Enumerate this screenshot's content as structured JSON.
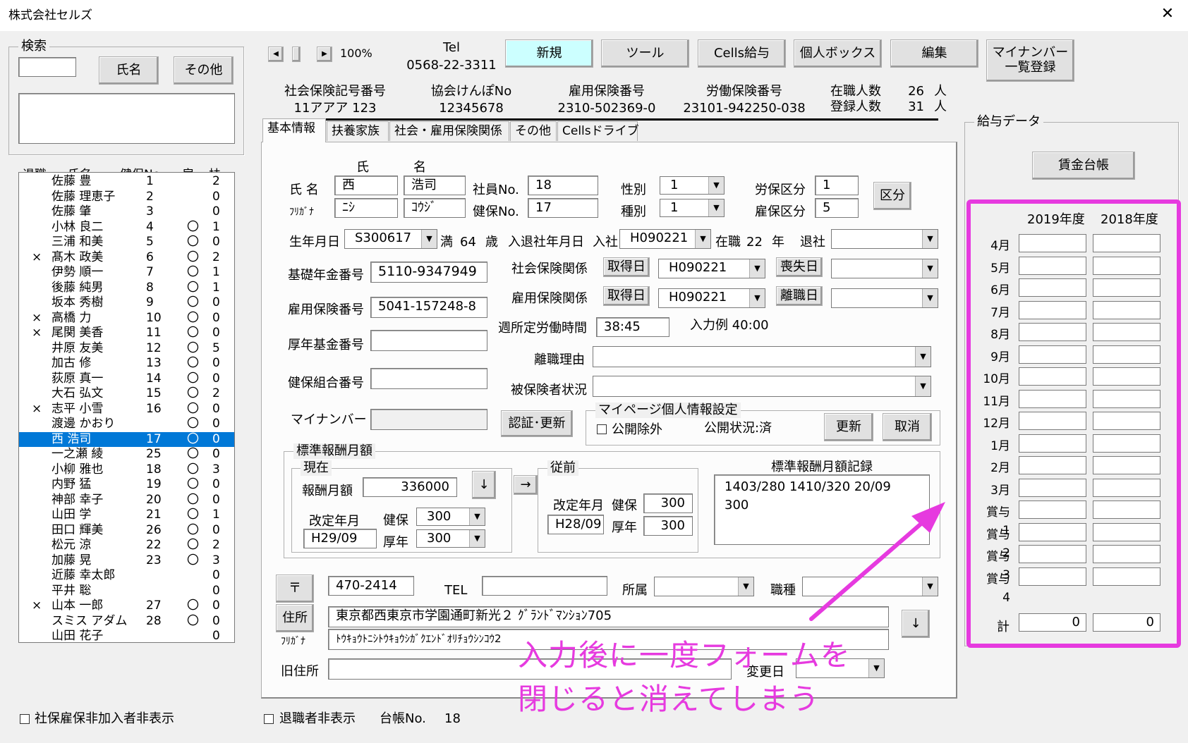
{
  "window": {
    "title": "株式会社セルズ",
    "close_glyph": "✕"
  },
  "search": {
    "label": "検索",
    "name_btn": "氏名",
    "other_btn": "その他",
    "input_value": "",
    "results": ""
  },
  "list": {
    "headers": [
      "退職",
      "氏名",
      "健保No",
      "雇",
      "扶"
    ],
    "rows": [
      [
        "",
        "佐藤 豊",
        "1",
        "",
        "2"
      ],
      [
        "",
        "佐藤 理恵子",
        "2",
        "",
        "0"
      ],
      [
        "",
        "佐藤 肇",
        "3",
        "",
        "0"
      ],
      [
        "",
        "小林 良二",
        "4",
        "〇",
        "1"
      ],
      [
        "",
        "三浦 和美",
        "5",
        "〇",
        "0"
      ],
      [
        "×",
        "髙木 政美",
        "6",
        "〇",
        "2"
      ],
      [
        "",
        "伊勢 順一",
        "7",
        "〇",
        "1"
      ],
      [
        "",
        "後藤 純男",
        "8",
        "〇",
        "1"
      ],
      [
        "",
        "坂本 秀樹",
        "9",
        "〇",
        "0"
      ],
      [
        "×",
        "高橋 力",
        "10",
        "〇",
        "0"
      ],
      [
        "×",
        "尾関 美香",
        "11",
        "〇",
        "0"
      ],
      [
        "",
        "井原 友美",
        "12",
        "〇",
        "5"
      ],
      [
        "",
        "加古 修",
        "13",
        "〇",
        "0"
      ],
      [
        "",
        "荻原 真一",
        "14",
        "〇",
        "0"
      ],
      [
        "",
        "大石 弘文",
        "15",
        "〇",
        "2"
      ],
      [
        "×",
        "志平 小雪",
        "16",
        "〇",
        "0"
      ],
      [
        "",
        "渡邊 かおり",
        "",
        "〇",
        "0"
      ],
      [
        "",
        "西 浩司",
        "17",
        "〇",
        "0"
      ],
      [
        "",
        "一之瀬 綾",
        "25",
        "〇",
        "0"
      ],
      [
        "",
        "小柳 雅也",
        "18",
        "〇",
        "3"
      ],
      [
        "",
        "内野 猛",
        "19",
        "〇",
        "0"
      ],
      [
        "",
        "神部 幸子",
        "20",
        "〇",
        "0"
      ],
      [
        "",
        "山田 学",
        "21",
        "〇",
        "1"
      ],
      [
        "",
        "田口 輝美",
        "26",
        "〇",
        "0"
      ],
      [
        "",
        "松元 涼",
        "22",
        "〇",
        "2"
      ],
      [
        "",
        "加藤 晃",
        "23",
        "〇",
        "3"
      ],
      [
        "",
        "近藤 幸太郎",
        "",
        "",
        "0"
      ],
      [
        "",
        "平井 聡",
        "",
        "",
        "0"
      ],
      [
        "×",
        "山本 一郎",
        "27",
        "〇",
        "0"
      ],
      [
        "",
        "スミス アダム",
        "28",
        "〇",
        "0"
      ],
      [
        "",
        "山田 花子",
        "",
        "",
        "0"
      ]
    ],
    "selected_index": 17
  },
  "bottom": {
    "hide_uninsured": "社保雇保非加入者非表示",
    "hide_retired": "退職者非表示",
    "ledger_label": "台帳No.",
    "ledger_no": "18"
  },
  "toolbar": {
    "prev": "◀",
    "next": "▶",
    "zoom": "100%",
    "tel_label": "Tel",
    "tel": "0568-22-3311",
    "new": "新規",
    "tools": "ツール",
    "cells_pay": "Cells給与",
    "personal_box": "個人ボックス",
    "edit": "編集",
    "mynumber_line1": "マイナンバー",
    "mynumber_line2": "一覧登録"
  },
  "company": {
    "shaho_label": "社会保険記号番号",
    "shaho": "11アアア 123",
    "kyokai_label": "協会けんぽNo",
    "kyokai": "12345678",
    "koyo_label": "雇用保険番号",
    "koyo": "2310-502369-0",
    "rodo_label": "労働保険番号",
    "rodo": "23101-942250-038",
    "active_label": "在職人数",
    "active": "26",
    "registered_label": "登録人数",
    "registered": "31",
    "unit": "人"
  },
  "tabs": [
    "基本情報",
    "扶養家族",
    "社会・雇用保険関係",
    "その他",
    "Cellsドライブ"
  ],
  "basic": {
    "sei_label": "氏",
    "mei_label": "名",
    "name_label": "氏 名",
    "furi_label": "ﾌﾘｶﾞﾅ",
    "sei": "西",
    "mei": "浩司",
    "sei_kana": "ﾆｼ",
    "mei_kana": "ｺｳｼﾞ",
    "emp_no_label": "社員No.",
    "emp_no": "18",
    "kenpo_no_label": "健保No.",
    "kenpo_no": "17",
    "gender_label": "性別",
    "gender": "1",
    "type_label": "種別",
    "type": "1",
    "rouho_label": "労保区分",
    "rouho": "1",
    "koho_label": "雇保区分",
    "koho": "5",
    "kubun_btn": "区分",
    "birth_label": "生年月日",
    "birth": "S300617",
    "age_prefix": "満",
    "age": "64",
    "age_suffix": "歳",
    "join_label": "入退社年月日",
    "join_word": "入社",
    "join": "H090221",
    "tenure_label": "在職",
    "tenure": "22",
    "tenure_unit": "年",
    "retire_label": "退社",
    "retire": "",
    "kiso_label": "基礎年金番号",
    "kiso": "5110-9347949",
    "koyo_label": "雇用保険番号",
    "koyo": "5041-157248-8",
    "kosei_label": "厚年基金番号",
    "kosei": "",
    "kumiai_label": "健保組合番号",
    "kumiai": "",
    "mynum_label": "マイナンバー",
    "mynum": "",
    "auth_btn": "認証･更新",
    "shaho_rel_label": "社会保険関係",
    "acquire_btn": "取得日",
    "shaho_acq": "H090221",
    "lose_btn": "喪失日",
    "shaho_lose": "",
    "koyo_rel_label": "雇用保険関係",
    "koyo_acq": "H090221",
    "leave_btn": "離職日",
    "koyo_leave": "",
    "hours_label": "週所定労働時間",
    "hours": "38:45",
    "hours_example": "入力例 40:00",
    "reason_label": "離職理由",
    "reason": "",
    "status_label": "被保険者状況",
    "status": "",
    "mypage_label": "マイページ個人情報設定",
    "exclude_label": "公開除外",
    "public_status": "公開状況:済",
    "update_btn": "更新",
    "cancel_btn": "取消"
  },
  "std": {
    "frame_label": "標準報酬月額",
    "current_label": "現在",
    "pay_label": "報酬月額",
    "pay": "336000",
    "down_btn": "↓",
    "revise_label": "改定年月",
    "revise": "H29/09",
    "kenpo_label": "健保",
    "kenpo": "300",
    "kosei_label": "厚年",
    "kosei": "300",
    "arrow_btn": "→",
    "prev_label": "従前",
    "prev_revise_label": "改定年月",
    "prev_revise": "H28/09",
    "prev_kenpo": "300",
    "prev_kosei": "300",
    "record_label": "標準報酬月額記録",
    "record_line1": "1403/280 1410/320  20/09",
    "record_line2": "300"
  },
  "addr": {
    "zip_btn": "〒",
    "zip": "470-2414",
    "tel_label": "TEL",
    "tel": "",
    "dept_label": "所属",
    "dept": "",
    "job_label": "職種",
    "job": "",
    "addr_btn": "住所",
    "furi_label": "ﾌﾘｶﾞﾅ",
    "address": "東京都西東京市学園通町新光２ ｸﾞﾗﾝﾄﾞﾏﾝｼｮﾝ705",
    "address_kana": "ﾄｳｷｮｳﾄﾆｼﾄｳｷｮｳｼｶﾞｸｴﾝﾄﾞｵﾘﾁｮｳｼﾝｺｳ2",
    "down_btn": "↓",
    "old_label": "旧住所",
    "old": "",
    "change_label": "変更日",
    "change": ""
  },
  "pay": {
    "frame_label": "給与データ",
    "ledger_btn": "賃金台帳",
    "year1": "2019年度",
    "year2": "2018年度",
    "months": [
      "4月",
      "5月",
      "6月",
      "7月",
      "8月",
      "9月",
      "10月",
      "11月",
      "12月",
      "1月",
      "2月",
      "3月",
      "賞与1",
      "賞与2",
      "賞与3",
      "賞与4"
    ],
    "total_label": "計",
    "total1": "0",
    "total2": "0"
  },
  "annotation": {
    "line1": "入力後に一度フォームを",
    "line2": "閉じると消えてしまう",
    "color": "#e63adf"
  }
}
